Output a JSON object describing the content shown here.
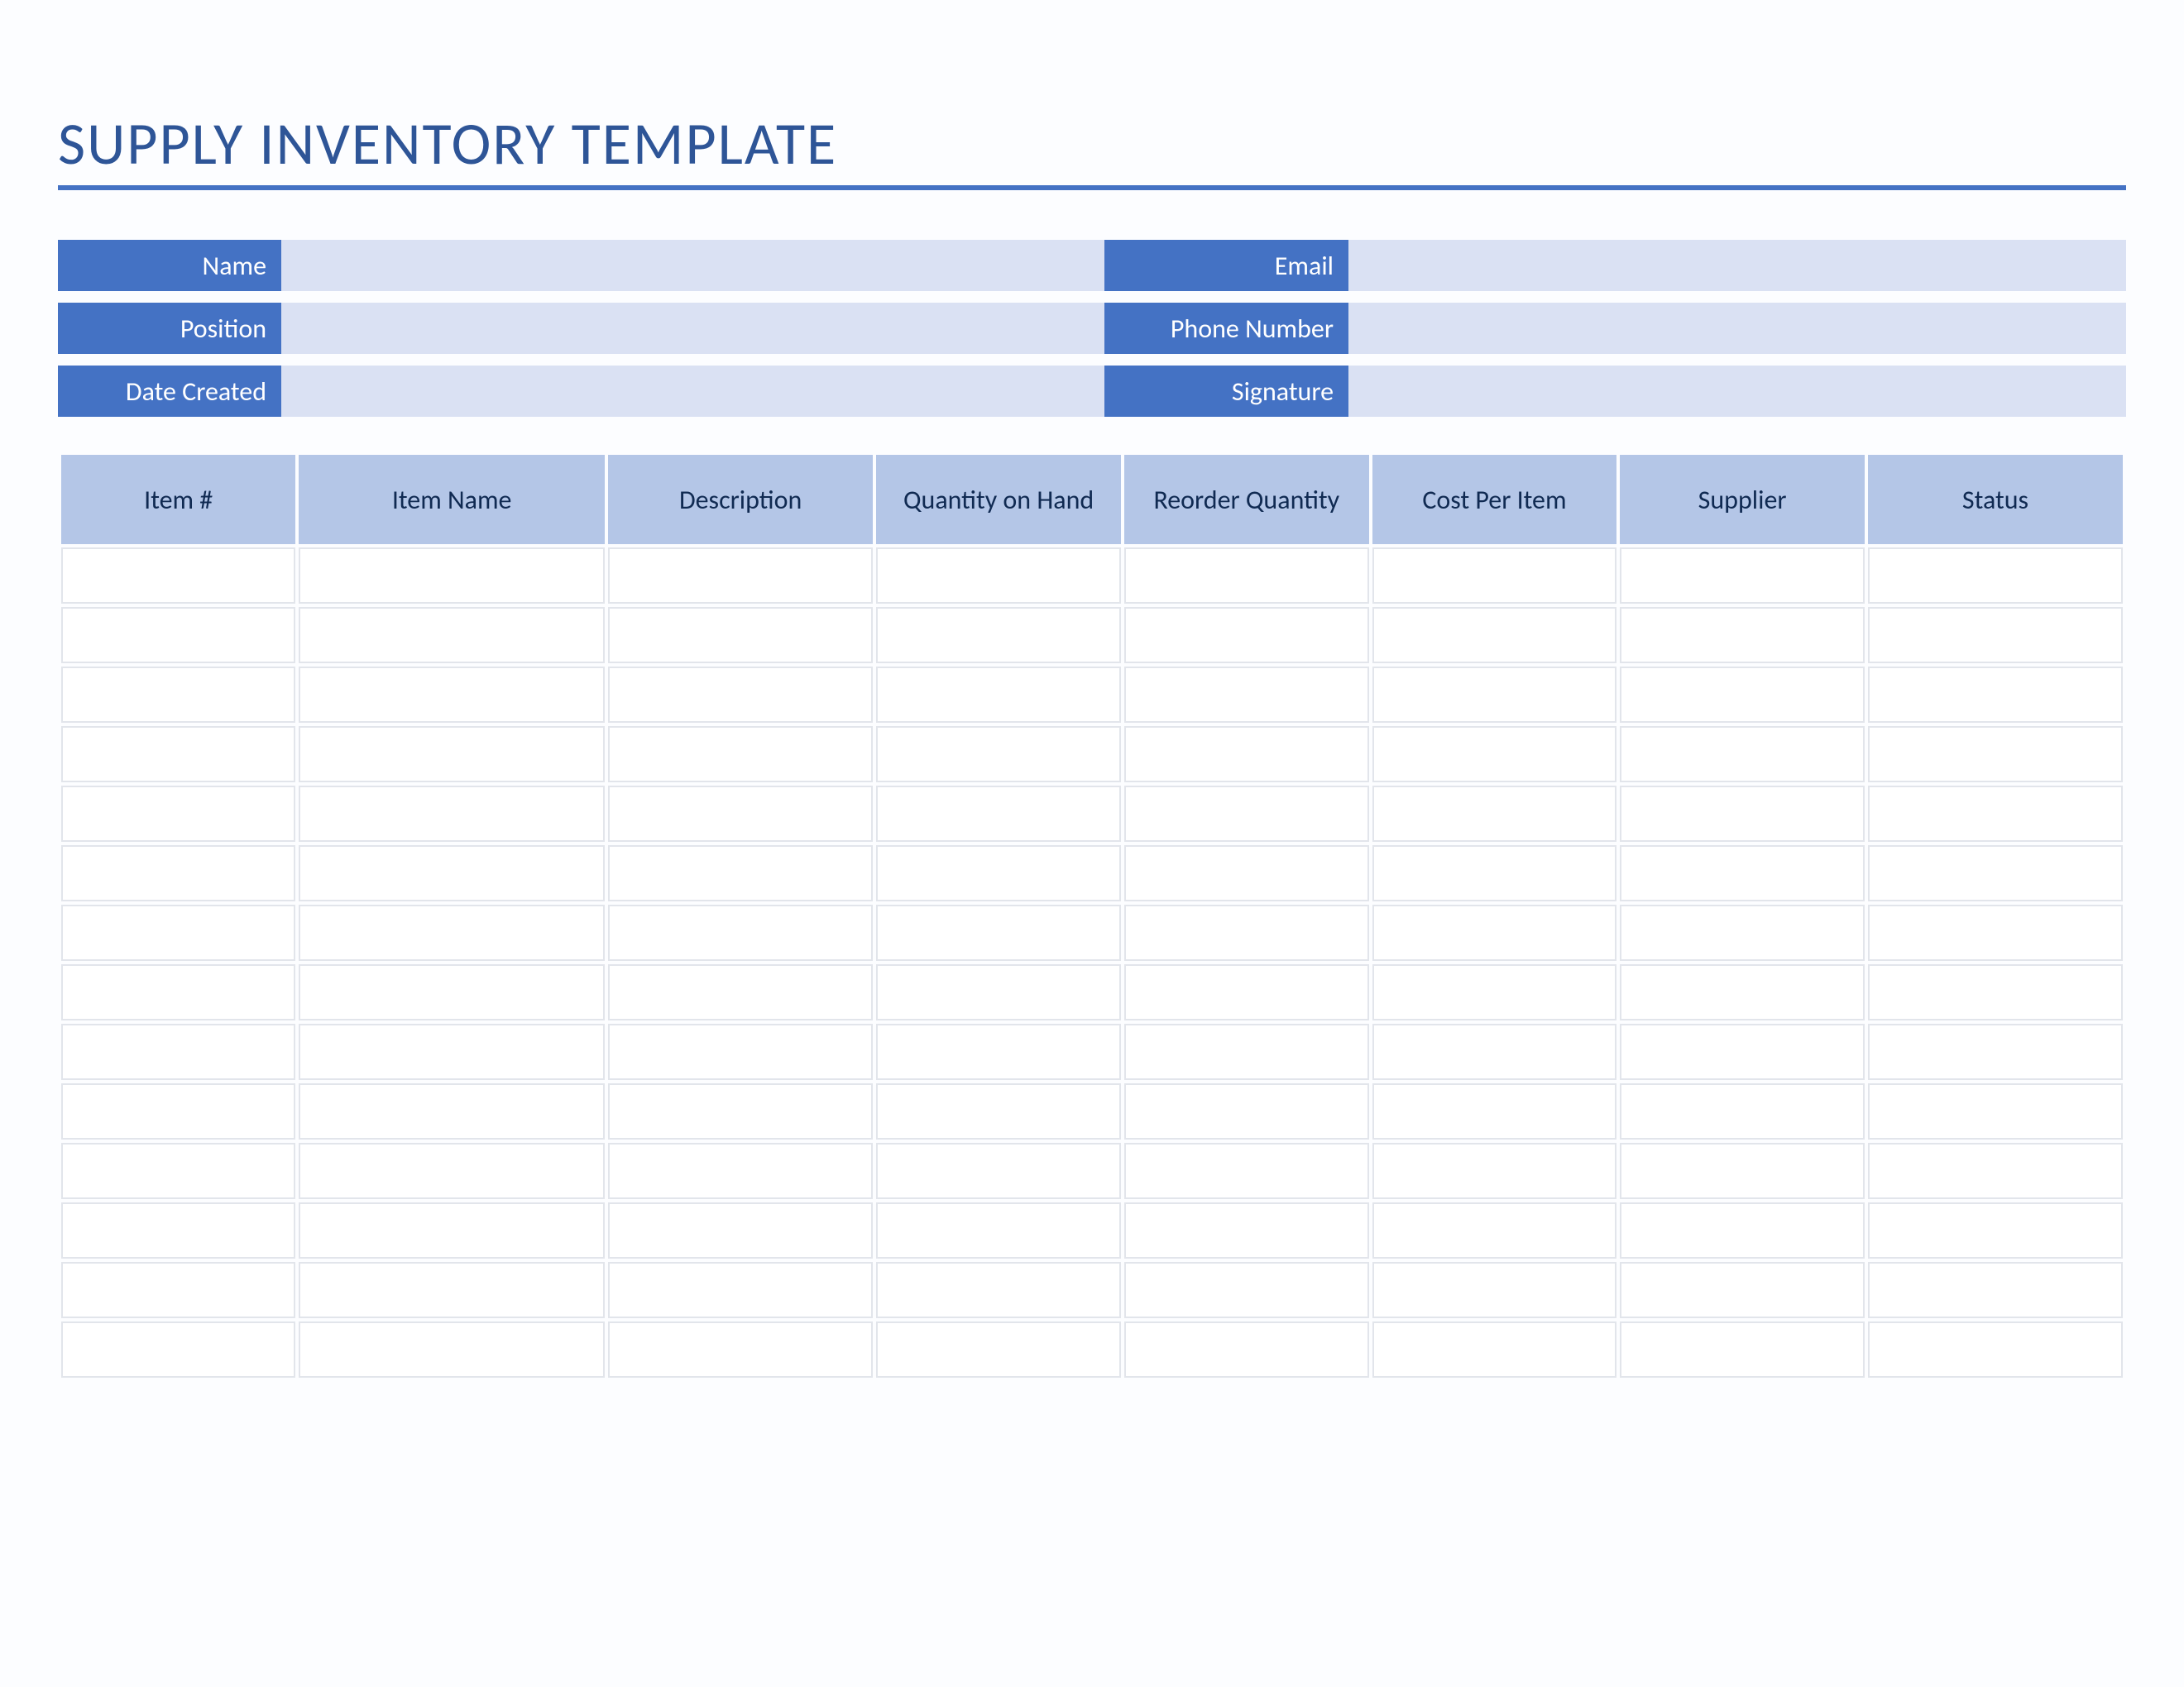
{
  "title": "SUPPLY INVENTORY TEMPLATE",
  "info": {
    "name_label": "Name",
    "name_value": "",
    "email_label": "Email",
    "email_value": "",
    "position_label": "Position",
    "position_value": "",
    "phone_label": "Phone Number",
    "phone_value": "",
    "date_label": "Date Created",
    "date_value": "",
    "signature_label": "Signature",
    "signature_value": ""
  },
  "table": {
    "columns": [
      "Item #",
      "Item Name",
      "Description",
      "Quantity on Hand",
      "Reorder Quantity",
      "Cost Per Item",
      "Supplier",
      "Status"
    ],
    "col_widths_pct": [
      11.5,
      15,
      13,
      12,
      12,
      12,
      12,
      12.5
    ],
    "num_rows": 14
  }
}
